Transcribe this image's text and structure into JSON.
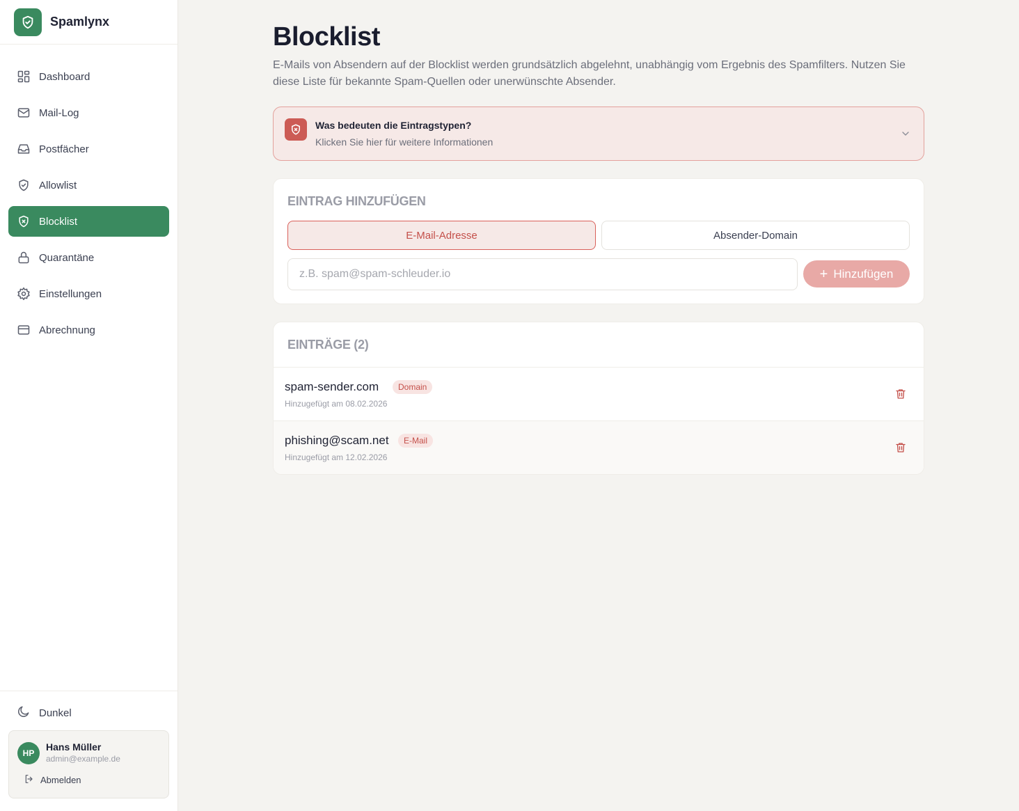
{
  "app": {
    "name": "Spamlynx"
  },
  "sidebar": {
    "items": [
      {
        "label": "Dashboard",
        "icon": "dashboard-icon"
      },
      {
        "label": "Mail-Log",
        "icon": "mail-icon"
      },
      {
        "label": "Postfächer",
        "icon": "inbox-icon"
      },
      {
        "label": "Allowlist",
        "icon": "shield-check-icon"
      },
      {
        "label": "Blocklist",
        "icon": "shield-x-icon",
        "active": true
      },
      {
        "label": "Quarantäne",
        "icon": "lock-icon"
      },
      {
        "label": "Einstellungen",
        "icon": "gear-icon"
      },
      {
        "label": "Abrechnung",
        "icon": "credit-card-icon"
      }
    ],
    "theme_label": "Dunkel",
    "user": {
      "initials": "HP",
      "name": "Hans Müller",
      "email": "admin@example.de",
      "logout_label": "Abmelden"
    }
  },
  "page": {
    "title": "Blocklist",
    "description": "E-Mails von Absendern auf der Blocklist werden grundsätzlich abgelehnt, unabhängig vom Ergebnis des Spamfilters. Nutzen Sie diese Liste für bekannte Spam-Quellen oder unerwünschte Absender."
  },
  "info": {
    "title": "Was bedeuten die Eintragstypen?",
    "subtitle": "Klicken Sie hier für weitere Informationen"
  },
  "add_entry": {
    "title": "EINTRAG HINZUFÜGEN",
    "type_email": "E-Mail-Adresse",
    "type_domain": "Absender-Domain",
    "selected_type": "E-Mail-Adresse",
    "input_value": "",
    "input_placeholder": "z.B. spam@spam-schleuder.io",
    "add_label": "Hinzufügen"
  },
  "entries": {
    "title": "EINTRÄGE (2)",
    "items": [
      {
        "name": "spam-sender.com",
        "type": "Domain",
        "date": "Hinzugefügt am 08.02.2026"
      },
      {
        "name": "phishing@scam.net",
        "type": "E-Mail",
        "date": "Hinzugefügt am 12.02.2026"
      }
    ]
  },
  "colors": {
    "accent": "#3a8a5f",
    "danger": "#cc5b55",
    "danger_bg": "#f6e9e7",
    "background": "#f4f3f0"
  }
}
